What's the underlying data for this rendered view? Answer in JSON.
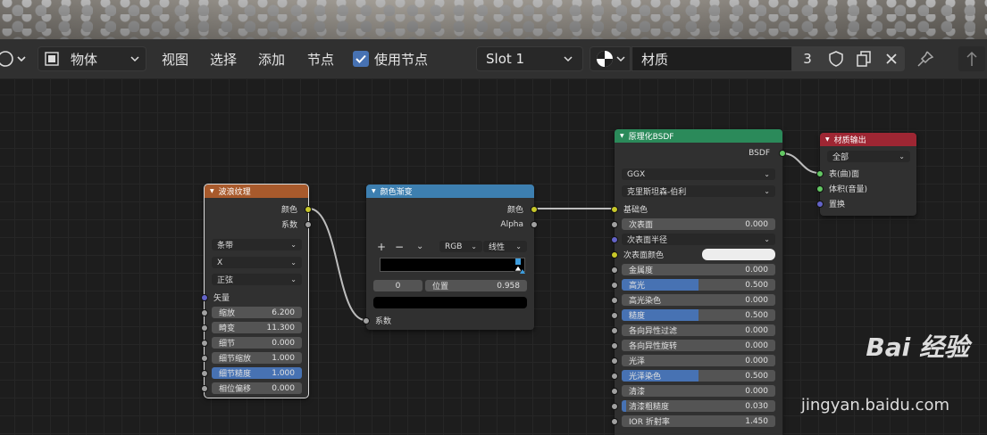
{
  "header": {
    "mode_label": "物体",
    "menus": [
      "视图",
      "选择",
      "添加",
      "节点"
    ],
    "use_nodes_label": "使用节点",
    "use_nodes_checked": true,
    "slot_label": "Slot 1",
    "material_name": "材质",
    "user_count": "3"
  },
  "colors": {
    "wave_header": "#a85a2c",
    "ramp_header": "#3d7fb0",
    "bsdf_header": "#2b8a5a",
    "output_header": "#9e2633",
    "accent_blue": "#4772b3"
  },
  "nodes": {
    "wave": {
      "title": "波浪纹理",
      "outputs": [
        "颜色",
        "系数"
      ],
      "type_select": "条带",
      "axis_select": "X",
      "profile_select": "正弦",
      "vector_label": "矢量",
      "fields": [
        {
          "label": "缩放",
          "value": "6.200"
        },
        {
          "label": "畸变",
          "value": "11.300"
        },
        {
          "label": "细节",
          "value": "0.000"
        },
        {
          "label": "细节缩放",
          "value": "1.000"
        },
        {
          "label": "细节糙度",
          "value": "1.000"
        },
        {
          "label": "相位偏移",
          "value": "0.000"
        }
      ]
    },
    "ramp": {
      "title": "颜色渐变",
      "outputs": [
        "颜色",
        "Alpha"
      ],
      "plus": "+",
      "minus": "−",
      "color_mode": "RGB",
      "interpolation": "线性",
      "stop_index": "0",
      "pos_label": "位置",
      "pos_value": "0.958",
      "input_label": "系数"
    },
    "bsdf": {
      "title": "原理化BSDF",
      "output": "BSDF",
      "distribution": "GGX",
      "subsurface_method": "克里斯坦森-伯利",
      "base_color_label": "基础色",
      "subsurface_label": "次表面",
      "subsurface_value": "0.000",
      "subsurface_radius_label": "次表面半径",
      "subsurface_color_label": "次表面颜色",
      "fields": [
        {
          "label": "金属度",
          "value": "0.000",
          "fill": 0
        },
        {
          "label": "高光",
          "value": "0.500",
          "fill": 50
        },
        {
          "label": "高光染色",
          "value": "0.000",
          "fill": 0
        },
        {
          "label": "糙度",
          "value": "0.500",
          "fill": 50
        },
        {
          "label": "各向异性过滤",
          "value": "0.000",
          "fill": 0
        },
        {
          "label": "各向异性旋转",
          "value": "0.000",
          "fill": 0
        },
        {
          "label": "光泽",
          "value": "0.000",
          "fill": 0
        },
        {
          "label": "光泽染色",
          "value": "0.500",
          "fill": 50
        },
        {
          "label": "清漆",
          "value": "0.000",
          "fill": 0
        },
        {
          "label": "清漆粗糙度",
          "value": "0.030",
          "fill": 3
        },
        {
          "label": "IOR 折射率",
          "value": "1.450",
          "fill": 0
        }
      ]
    },
    "output": {
      "title": "材质输出",
      "target": "全部",
      "inputs": [
        "表(曲)面",
        "体积(音量)",
        "置换"
      ]
    }
  },
  "watermark": {
    "text": "Bai 经验",
    "url": "jingyan.baidu.com"
  }
}
